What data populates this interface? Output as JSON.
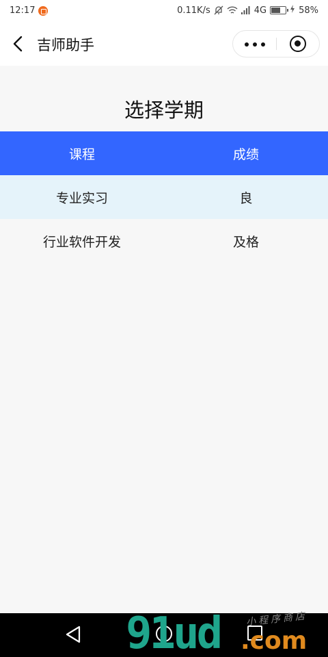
{
  "status_bar": {
    "time": "12:17",
    "network_speed": "0.11K/s",
    "network_type": "4G",
    "battery": "58%"
  },
  "nav_bar": {
    "title": "吉师助手"
  },
  "page": {
    "title": "选择学期"
  },
  "table": {
    "headers": [
      "课程",
      "成绩"
    ],
    "rows": [
      {
        "course": "专业实习",
        "grade": "良"
      },
      {
        "course": "行业软件开发",
        "grade": "及格"
      }
    ]
  },
  "watermark": {
    "main": "91ud",
    "suffix": ".com",
    "small": "小程序商店"
  },
  "colors": {
    "header_bg": "#3366ff",
    "row_alt_bg": "#e5f3fa",
    "page_bg": "#f7f7f7"
  }
}
